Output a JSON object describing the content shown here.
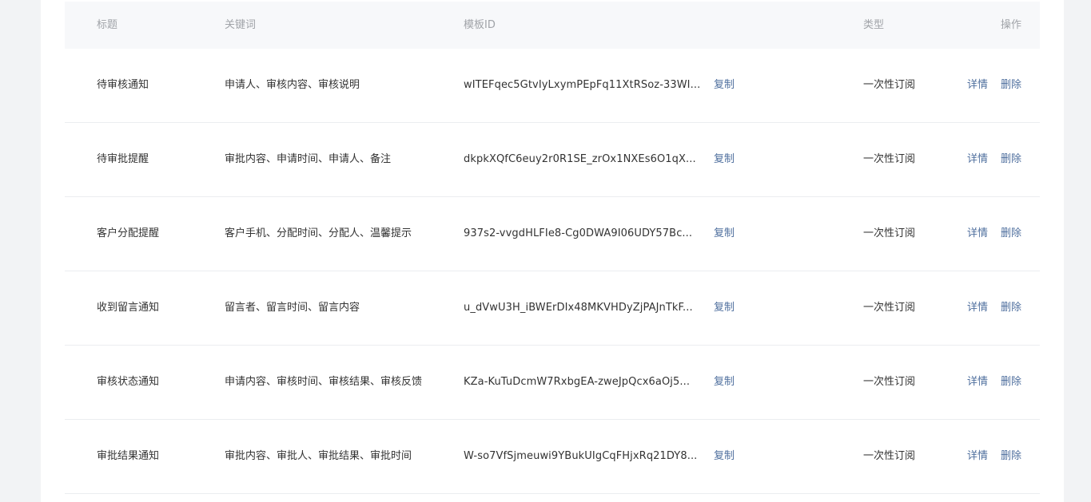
{
  "table": {
    "headers": {
      "title": "标题",
      "keywords": "关键词",
      "template_id": "模板ID",
      "type": "类型",
      "operations": "操作"
    },
    "rows": [
      {
        "title": "待审核通知",
        "keywords": "申请人、审核内容、审核说明",
        "template_id": "wITEFqec5GtvIyLxymPEpFq11XtRSoz-33WI...",
        "copy": "复制",
        "type": "一次性订阅",
        "detail": "详情",
        "delete": "删除"
      },
      {
        "title": "待审批提醒",
        "keywords": "审批内容、申请时间、申请人、备注",
        "template_id": "dkpkXQfC6euy2r0R1SE_zrOx1NXEs6O1qX...",
        "copy": "复制",
        "type": "一次性订阅",
        "detail": "详情",
        "delete": "删除"
      },
      {
        "title": "客户分配提醒",
        "keywords": "客户手机、分配时间、分配人、温馨提示",
        "template_id": "937s2-vvgdHLFIe8-Cg0DWA9I06UDY57Bc...",
        "copy": "复制",
        "type": "一次性订阅",
        "detail": "详情",
        "delete": "删除"
      },
      {
        "title": "收到留言通知",
        "keywords": "留言者、留言时间、留言内容",
        "template_id": "u_dVwU3H_iBWErDIx48MKVHDyZjPAJnTkF...",
        "copy": "复制",
        "type": "一次性订阅",
        "detail": "详情",
        "delete": "删除"
      },
      {
        "title": "审核状态通知",
        "keywords": "申请内容、审核时间、审核结果、审核反馈",
        "template_id": "KZa-KuTuDcmW7RxbgEA-zweJpQcx6aOj5...",
        "copy": "复制",
        "type": "一次性订阅",
        "detail": "详情",
        "delete": "删除"
      },
      {
        "title": "审批结果通知",
        "keywords": "审批内容、审批人、审批结果、审批时间",
        "template_id": "W-so7VfSjmeuwi9YBukUIgCqFHjxRq21DY8...",
        "copy": "复制",
        "type": "一次性订阅",
        "detail": "详情",
        "delete": "删除"
      }
    ]
  }
}
